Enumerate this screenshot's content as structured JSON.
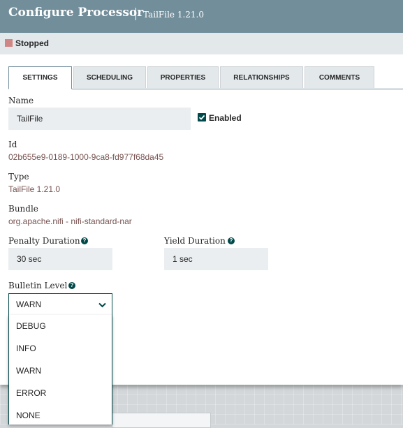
{
  "header": {
    "title": "Configure Processor",
    "subtitle": "TailFile 1.21.0"
  },
  "status": {
    "text": "Stopped",
    "color": "#d18686"
  },
  "tabs": [
    {
      "label": "SETTINGS",
      "active": true
    },
    {
      "label": "SCHEDULING"
    },
    {
      "label": "PROPERTIES"
    },
    {
      "label": "RELATIONSHIPS"
    },
    {
      "label": "COMMENTS"
    }
  ],
  "settings": {
    "name_label": "Name",
    "name_value": "TailFile",
    "enabled_label": "Enabled",
    "enabled": true,
    "id_label": "Id",
    "id_value": "02b655e9-0189-1000-9ca8-fd977f68da45",
    "type_label": "Type",
    "type_value": "TailFile 1.21.0",
    "bundle_label": "Bundle",
    "bundle_value": "org.apache.nifi - nifi-standard-nar",
    "penalty_label": "Penalty Duration",
    "penalty_value": "30 sec",
    "yield_label": "Yield Duration",
    "yield_value": "1 sec",
    "bulletin_label": "Bulletin Level",
    "bulletin_value": "WARN",
    "bulletin_options": [
      "DEBUG",
      "INFO",
      "WARN",
      "ERROR",
      "NONE"
    ]
  },
  "icons": {
    "help": "question-circle-icon",
    "chevron": "chevron-down-icon",
    "check": "check-icon"
  }
}
